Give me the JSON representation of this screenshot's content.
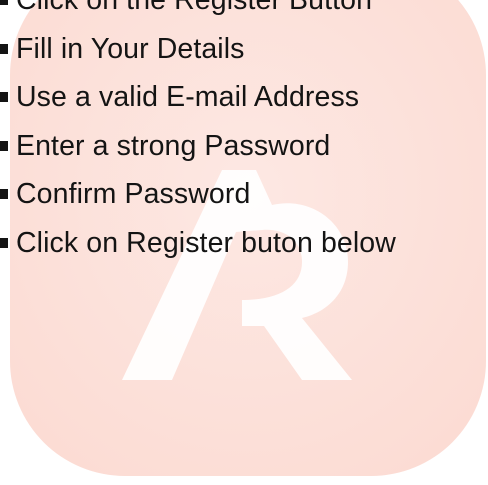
{
  "instructions": {
    "items": [
      {
        "label": "Click on the Register Button"
      },
      {
        "label": "Fill in Your Details"
      },
      {
        "label": "Use a valid E-mail Address"
      },
      {
        "label": "Enter a strong Password"
      },
      {
        "label": "Confirm Password"
      },
      {
        "label": "Click on Register buton below"
      }
    ]
  },
  "watermark": {
    "icon": "ar-logo-icon",
    "tile_color": "#fde3dd",
    "glyph_color": "#ffffff"
  },
  "colors": {
    "text": "#141414",
    "background": "#ffffff"
  }
}
